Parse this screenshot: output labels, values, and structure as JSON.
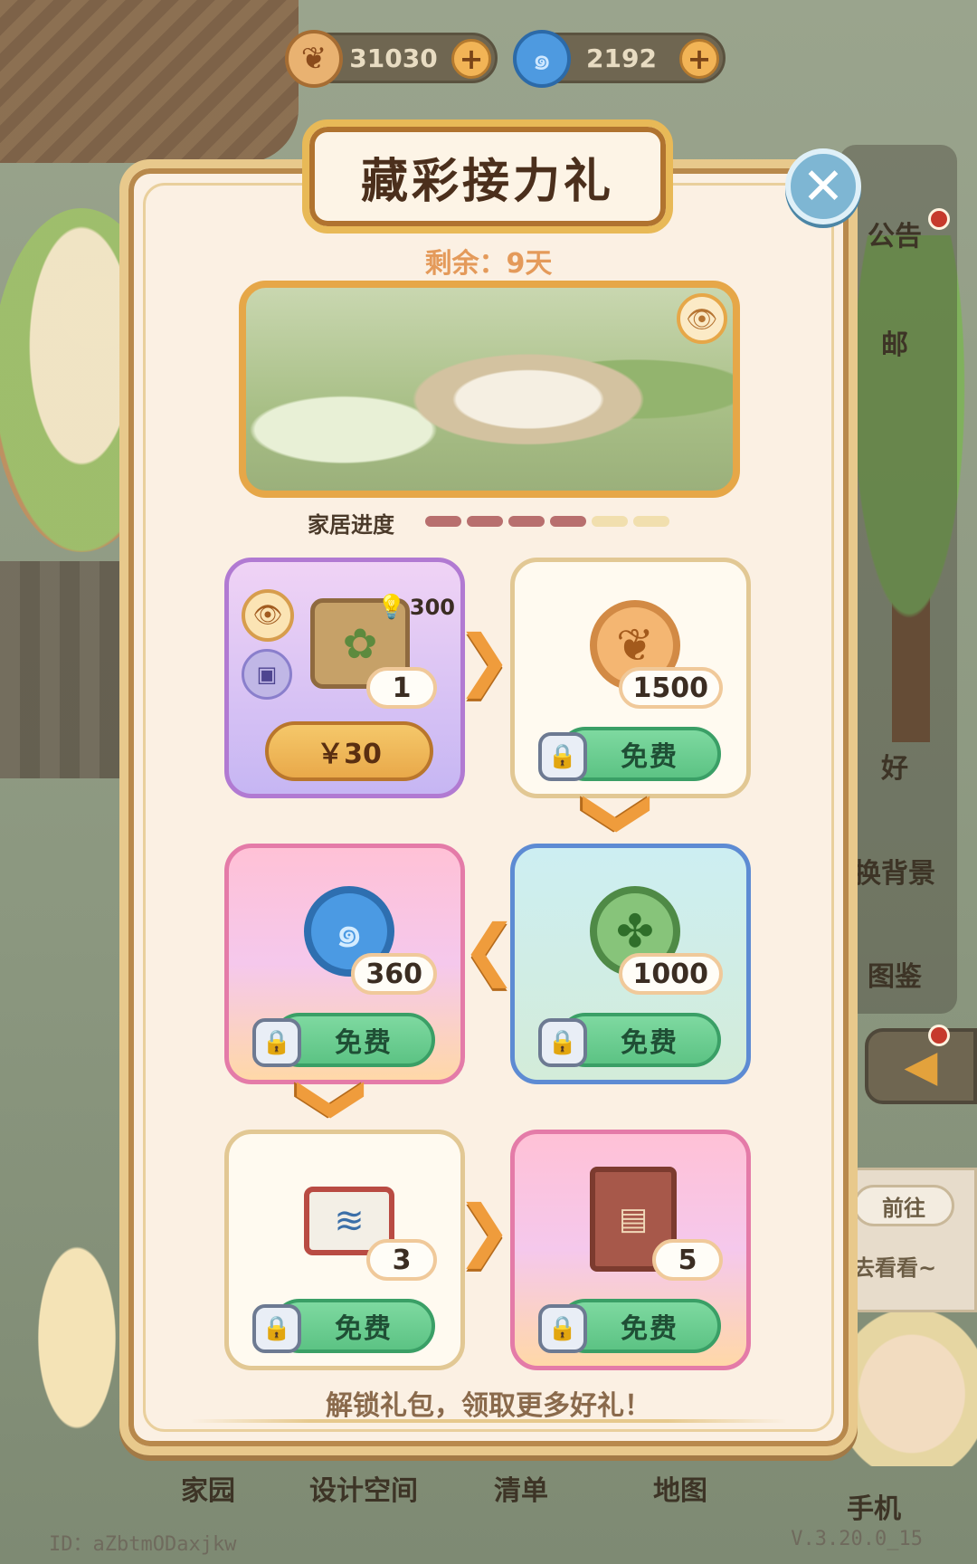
{
  "currencies": [
    {
      "name": "wood-coin",
      "value": "31030",
      "icon": "leaf-coin-icon",
      "plus": "+"
    },
    {
      "name": "blue-orb",
      "value": "2192",
      "icon": "swirl-orb-icon",
      "plus": "+"
    }
  ],
  "modal": {
    "title": "藏彩接力礼",
    "remaining": "剩余：9天",
    "progress_label": "家居进度",
    "progress": {
      "filled": 4,
      "total": 6
    },
    "footer": "解锁礼包，领取更多好礼！",
    "close": "✕"
  },
  "cards": {
    "paid": {
      "bulb_value": "300",
      "qty": "1",
      "price": "￥30"
    },
    "wood": {
      "qty": "1500",
      "button": "免费"
    },
    "leaf": {
      "qty": "1000",
      "button": "免费"
    },
    "orb": {
      "qty": "360",
      "button": "免费"
    },
    "sketch": {
      "qty": "3",
      "button": "免费"
    },
    "book": {
      "qty": "5",
      "button": "免费"
    }
  },
  "side_menu": {
    "items": [
      "公告",
      "邮",
      "好",
      "换背景",
      "图鉴"
    ],
    "goto": "前往",
    "goto_text": "去看看~"
  },
  "bottom_nav": [
    "家园",
    "设计空间",
    "清单",
    "地图",
    "手机"
  ],
  "footer": {
    "id": "ID：aZbtmODaxjkw",
    "version": "V.3.20.0_15"
  },
  "colors": {
    "modal_bg": "#fbf0e3",
    "gold_border": "#e8c98c",
    "free_button": "#5cc384",
    "price_button": "#e9a94a"
  }
}
